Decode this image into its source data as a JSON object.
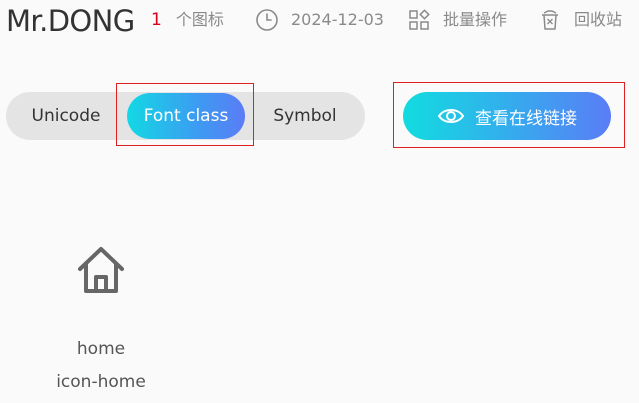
{
  "header": {
    "brand": "Mr.DONG",
    "icon_count": "1",
    "icon_count_label": "个图标",
    "date": "2024-12-03",
    "batch_label": "批量操作",
    "recycle_label": "回收站"
  },
  "switch": {
    "tabs": [
      "Unicode",
      "Font class",
      "Symbol"
    ],
    "active": "Font class"
  },
  "link_button": {
    "label": "查看在线链接"
  },
  "icons": [
    {
      "name": "home",
      "class": "icon-home",
      "icon": "home-icon"
    }
  ],
  "colors": {
    "brand_text": "#333333",
    "count_red": "#d9001b",
    "gradient_start": "#12d9e4",
    "gradient_end": "#5b7cf6",
    "highlight_border": "#e02020"
  }
}
